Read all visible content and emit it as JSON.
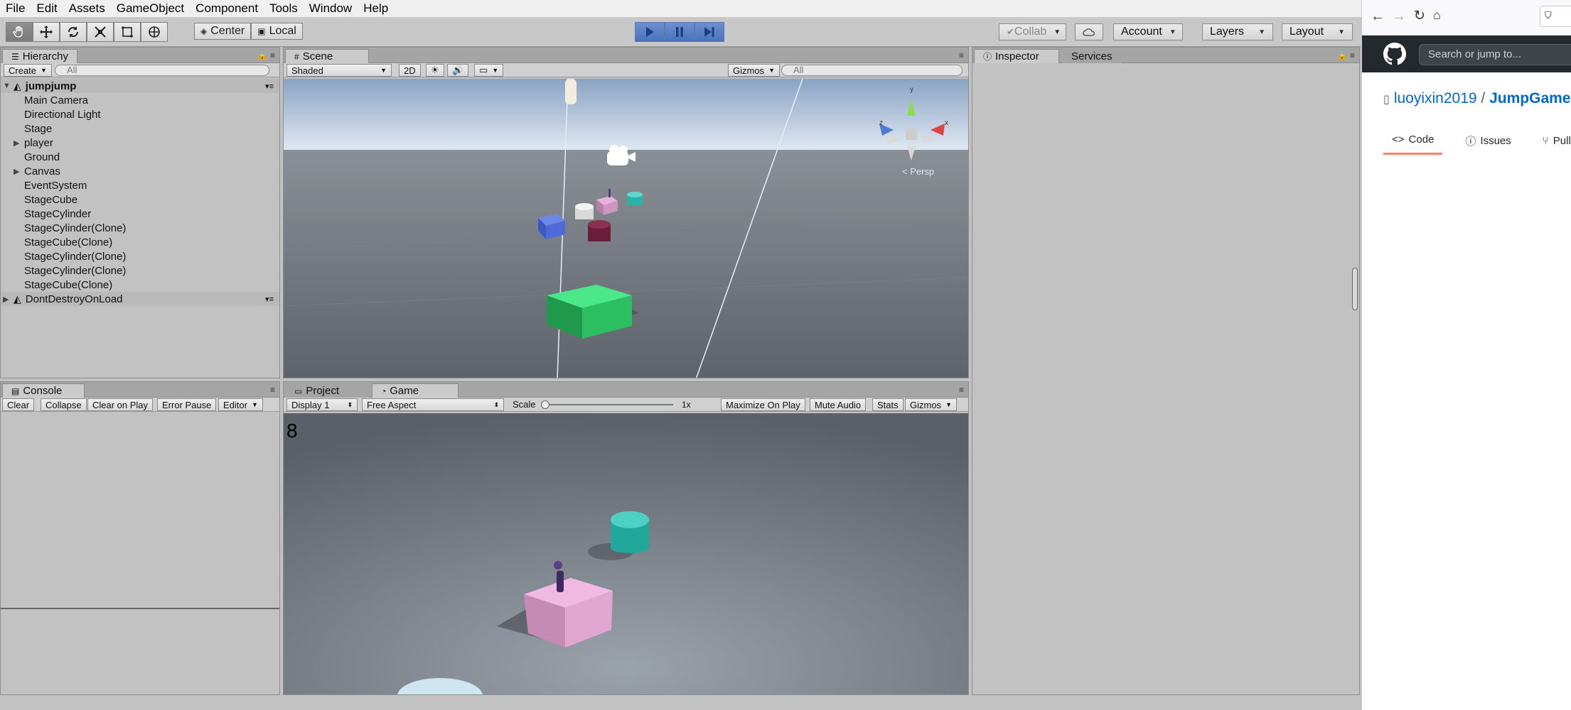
{
  "menu": [
    "File",
    "Edit",
    "Assets",
    "GameObject",
    "Component",
    "Tools",
    "Window",
    "Help"
  ],
  "toolbar": {
    "pivot_label": "Center",
    "space_label": "Local",
    "collab_label": "Collab",
    "account_label": "Account",
    "layers_label": "Layers",
    "layout_label": "Layout"
  },
  "hierarchy": {
    "tab": "Hierarchy",
    "create_label": "Create",
    "search_placeholder": "All",
    "scene_name": "jumpjump",
    "items": [
      {
        "label": "Main Camera",
        "expandable": false
      },
      {
        "label": "Directional Light",
        "expandable": false
      },
      {
        "label": "Stage",
        "expandable": false
      },
      {
        "label": "player",
        "expandable": true
      },
      {
        "label": "Ground",
        "expandable": false
      },
      {
        "label": "Canvas",
        "expandable": true
      },
      {
        "label": "EventSystem",
        "expandable": false
      },
      {
        "label": "StageCube",
        "expandable": false
      },
      {
        "label": "StageCylinder",
        "expandable": false
      },
      {
        "label": "StageCylinder(Clone)",
        "expandable": false
      },
      {
        "label": "StageCube(Clone)",
        "expandable": false
      },
      {
        "label": "StageCylinder(Clone)",
        "expandable": false
      },
      {
        "label": "StageCylinder(Clone)",
        "expandable": false
      },
      {
        "label": "StageCube(Clone)",
        "expandable": false
      }
    ],
    "dontdestroy_label": "DontDestroyOnLoad"
  },
  "scene": {
    "tab": "Scene",
    "shading": "Shaded",
    "mode_2d": "2D",
    "gizmos_label": "Gizmos",
    "search_placeholder": "All",
    "persp_label": "Persp",
    "axis_y": "y",
    "axis_x": "x",
    "axis_z": "z"
  },
  "console": {
    "tab": "Console",
    "buttons": [
      "Clear",
      "Collapse",
      "Clear on Play",
      "Error Pause",
      "Editor"
    ]
  },
  "bottom_tabs": {
    "project": "Project",
    "game": "Game"
  },
  "game": {
    "display": "Display 1",
    "aspect": "Free Aspect",
    "scale_label": "Scale",
    "scale_value": 0.0,
    "scale_readout": "1x",
    "maximize": "Maximize On Play",
    "mute": "Mute Audio",
    "stats": "Stats",
    "gizmos": "Gizmos",
    "score": "8"
  },
  "inspector": {
    "tab": "Inspector",
    "services_tab": "Services"
  },
  "browser": {
    "search_placeholder": "Search or jump to...",
    "repo_owner": "luoyixin2019",
    "repo_sep": "/",
    "repo_name": "JumpGame",
    "tabs": [
      "Code",
      "Issues",
      "Pull req"
    ]
  },
  "colors": {
    "play_blue": "#4a72bd",
    "github_dark": "#24292e",
    "link_blue": "#0366d6",
    "tab_underline": "#f9826c",
    "panel_gray": "#c2c2c2"
  }
}
